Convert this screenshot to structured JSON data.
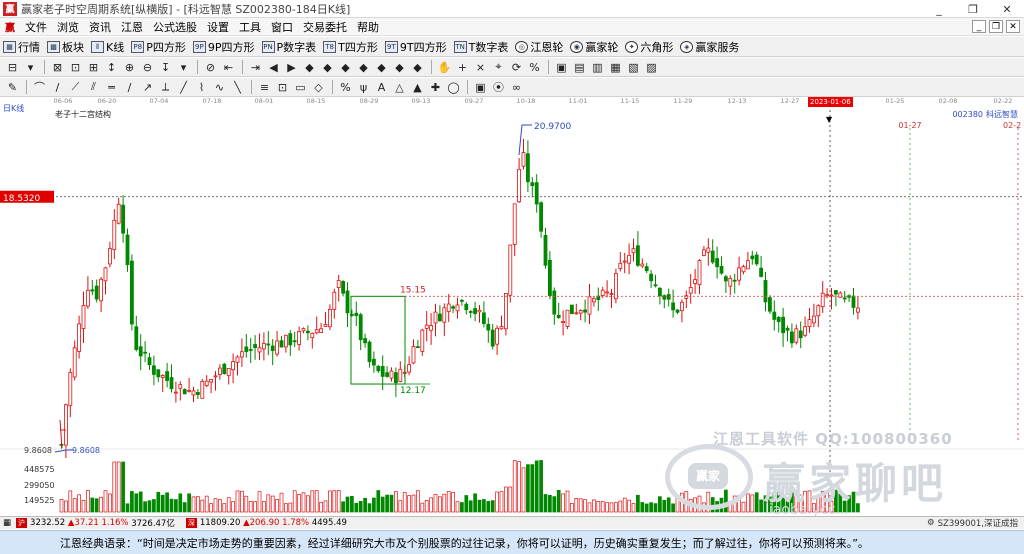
{
  "window": {
    "title": "赢家老子时空周期系统[纵横版] - [科远智慧  SZ002380-184日K线]",
    "minimize": "_",
    "restore": "❐",
    "close": "✕"
  },
  "menu": {
    "logo": "赢",
    "items": [
      "文件",
      "浏览",
      "资讯",
      "江恩",
      "公式选股",
      "设置",
      "工具",
      "窗口",
      "交易委托",
      "帮助"
    ],
    "mdi": [
      "_",
      "❐",
      "✕"
    ]
  },
  "toolbar1": [
    {
      "icon": "grid-icon",
      "glyph": "▦",
      "label": "行情"
    },
    {
      "icon": "blocks-icon",
      "glyph": "▩",
      "label": "板块"
    },
    {
      "icon": "kline-icon",
      "glyph": "⫴",
      "label": "K线"
    },
    {
      "icon": "p-square-icon",
      "glyph": "P8",
      "label": "P四方形"
    },
    {
      "icon": "9p-square-icon",
      "glyph": "9P",
      "label": "9P四方形"
    },
    {
      "icon": "pn-table-icon",
      "glyph": "PN",
      "label": "P数字表"
    },
    {
      "icon": "t-square-icon",
      "glyph": "T8",
      "label": "T四方形"
    },
    {
      "icon": "9t-square-icon",
      "glyph": "9T",
      "label": "9T四方形"
    },
    {
      "icon": "tn-table-icon",
      "glyph": "TN",
      "label": "T数字表"
    },
    {
      "icon": "gann-wheel-icon",
      "glyph": "◎",
      "label": "江恩轮",
      "round": true
    },
    {
      "icon": "winner-wheel-icon",
      "glyph": "◉",
      "label": "赢家轮",
      "round": true
    },
    {
      "icon": "hexagon-icon",
      "glyph": "✦",
      "label": "六角形",
      "round": true
    },
    {
      "icon": "service-icon",
      "glyph": "◈",
      "label": "赢家服务",
      "round": true
    }
  ],
  "toolbar2": [
    "⊟",
    "▾",
    "⊠",
    "⊡",
    "⊞",
    "↕",
    "⊕",
    "⊖",
    "↧",
    "▾",
    "⊘",
    "⇤",
    "⇥",
    "◀",
    "▶",
    "◆",
    "◆",
    "◆",
    "◆",
    "◆",
    "◆",
    "◆",
    "✋",
    "+",
    "⨯",
    "⌖",
    "⟳",
    "%",
    "▣",
    "▤",
    "▥",
    "▦",
    "▧",
    "▨"
  ],
  "toolbar3": [
    "✎",
    "⌒",
    "/",
    "⟋",
    "⫽",
    "═",
    "∕",
    "↗",
    "⟂",
    "╱",
    "⌇",
    "∿",
    "╲",
    "≡",
    "⊡",
    "▭",
    "◇",
    "%",
    "ψ",
    "A",
    "△",
    "▲",
    "✚",
    "◯",
    "▣",
    "⦿",
    "∞"
  ],
  "dates": [
    "06-06",
    "06-20",
    "07-04",
    "07-18",
    "08-01",
    "08-15",
    "08-29",
    "09-13",
    "09-27",
    "10-18",
    "11-01",
    "11-15",
    "11-29",
    "12-13",
    "12-27",
    "2023-01-06",
    "01-25",
    "02-08",
    "02-22"
  ],
  "period": "日K线",
  "indicator": "老子十二宫结构",
  "stock": {
    "code": "002380",
    "name": "科远智慧"
  },
  "chart_data": {
    "type": "candlestick",
    "price_labels": {
      "cursor_price": "18.5320",
      "high": "20.9700",
      "low": "9.8608",
      "box_top": "15.15",
      "box_bottom": "12.17",
      "left_axis_low": "9.8608"
    },
    "volume_axis": [
      "448575",
      "299050",
      "149525"
    ],
    "forecast_dates": [
      "01-27",
      "02-2"
    ],
    "cursor_date": "2023-01-06"
  },
  "watermark": {
    "line1": "江恩工具软件  QQ:100800360",
    "logo_text": "赢家",
    "big": "赢家聊吧",
    "url": "liaoba.ycc..."
  },
  "status": {
    "sh": {
      "badge": "沪",
      "price": "3232.52",
      "chg": "▲37.21",
      "pct": "1.16%",
      "amt": "3726.47亿"
    },
    "sz": {
      "badge": "深",
      "price": "11809.20",
      "chg": "▲206.90",
      "pct": "1.78%",
      "amt": "4495.49"
    },
    "right": "SZ399001,深证成指"
  },
  "quote": "江恩经典语录：“时间是决定市场走势的重要因素，经过详细研究大市及个别股票的过往记录，你将可以证明，历史确实重复发生；而了解过往，你将可以预测将来。”。"
}
